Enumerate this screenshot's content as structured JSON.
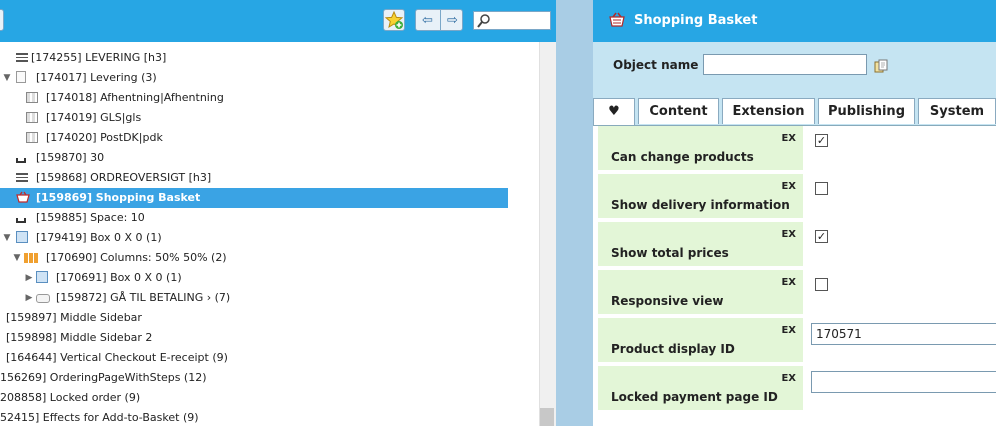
{
  "left_toolbar": {
    "favorites_icon": "star-add-icon",
    "back_icon": "arrow-left-icon",
    "forward_icon": "arrow-right-icon",
    "search_icon": "magnifier-icon",
    "search_value": ""
  },
  "tree": [
    {
      "text": "[174255] LEVERING [h3]",
      "icon": "heading-icon"
    },
    {
      "text": "[174017] Levering (3)",
      "icon": "document-icon",
      "toggle": "▼"
    },
    {
      "text": "[174018] Afhentning|Afhentning",
      "icon": "table-icon"
    },
    {
      "text": "[174019] GLS|gls",
      "icon": "table-icon"
    },
    {
      "text": "[174020] PostDK|pdk",
      "icon": "table-icon"
    },
    {
      "text": "[159870] 30",
      "icon": "space-icon"
    },
    {
      "text": "[159868] ORDREOVERSIGT [h3]",
      "icon": "heading-icon"
    },
    {
      "text": "[159869] Shopping Basket",
      "icon": "basket-icon",
      "selected": true
    },
    {
      "text": "[159885] Space: 10",
      "icon": "space-icon"
    },
    {
      "text": "[179419] Box 0 X 0 (1)",
      "icon": "box-icon",
      "toggle": "▼"
    },
    {
      "text": "[170690] Columns: 50% 50% (2)",
      "icon": "columns-icon",
      "toggle": "▼"
    },
    {
      "text": "[170691] Box 0 X 0 (1)",
      "icon": "box-icon",
      "toggle": "▶"
    },
    {
      "text": "[159872] GÅ TIL BETALING    › (7)",
      "icon": "button-icon",
      "toggle": "▶"
    },
    {
      "text": "[159897] Middle Sidebar"
    },
    {
      "text": "[159898] Middle Sidebar 2"
    },
    {
      "text": "[164644] Vertical Checkout E-receipt (9)"
    },
    {
      "text": "156269] OrderingPageWithSteps (12)"
    },
    {
      "text": "208858] Locked order (9)"
    },
    {
      "text": "52415] Effects for Add-to-Basket (9)"
    }
  ],
  "editor": {
    "title": "Shopping Basket",
    "title_icon": "basket-icon",
    "object_name_label": "Object name",
    "object_name_value": "",
    "browse_icon": "browse-icon",
    "tabs": [
      {
        "label": "♥",
        "icon": "heart-icon",
        "active": true
      },
      {
        "label": "Content"
      },
      {
        "label": "Extension"
      },
      {
        "label": "Publishing"
      },
      {
        "label": "System"
      }
    ],
    "properties": [
      {
        "label": "Can change products",
        "badge": "EX",
        "type": "checkbox",
        "checked": true
      },
      {
        "label": "Show delivery information",
        "badge": "EX",
        "type": "checkbox",
        "checked": false
      },
      {
        "label": "Show total prices",
        "badge": "EX",
        "type": "checkbox",
        "checked": true
      },
      {
        "label": "Responsive view",
        "badge": "EX",
        "type": "checkbox",
        "checked": false
      },
      {
        "label": "Product display ID",
        "badge": "EX",
        "type": "text",
        "value": "170571"
      },
      {
        "label": "Locked payment page ID",
        "badge": "EX",
        "type": "text",
        "value": ""
      }
    ]
  },
  "colors": {
    "header_blue": "#27a6e4",
    "selection_blue": "#3aa3e4",
    "panel_light_blue": "#c5e4f2",
    "property_green": "#e3f6d7"
  }
}
